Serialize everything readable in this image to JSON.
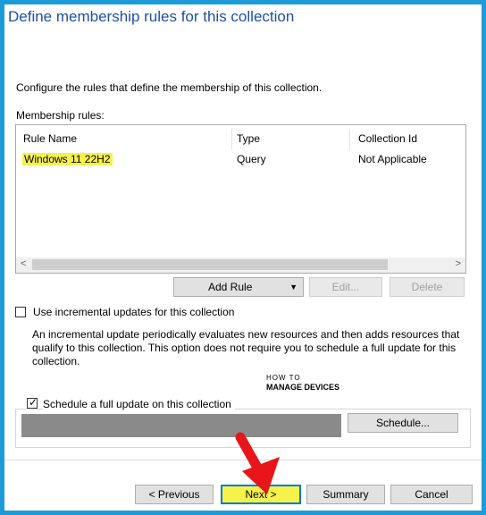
{
  "title": "Define membership rules for this collection",
  "description": "Configure the rules that define the membership of this collection.",
  "membership_label": "Membership rules:",
  "table": {
    "columns": [
      "Rule Name",
      "Type",
      "Collection Id"
    ],
    "rows": [
      {
        "name": "Windows 11 22H2",
        "type": "Query",
        "collection_id": "Not Applicable"
      }
    ]
  },
  "buttons": {
    "add_rule": "Add Rule",
    "edit": "Edit...",
    "delete": "Delete",
    "schedule": "Schedule...",
    "previous": "< Previous",
    "next": "Next >",
    "summary": "Summary",
    "cancel": "Cancel"
  },
  "incremental": {
    "label": "Use incremental updates for this collection",
    "checked": false,
    "note": "An incremental update periodically evaluates new resources and then adds resources that qualify to this collection. This option does not require you to schedule a full update for this collection."
  },
  "full_update": {
    "label": "Schedule a full update on this collection",
    "checked": true
  },
  "watermark": {
    "line1": "HOW TO",
    "line2": "MANAGE DEVICES"
  },
  "colors": {
    "highlight": "#f6f24a",
    "annotation_arrow": "#e8161a",
    "frame": "#1d9bd8"
  }
}
